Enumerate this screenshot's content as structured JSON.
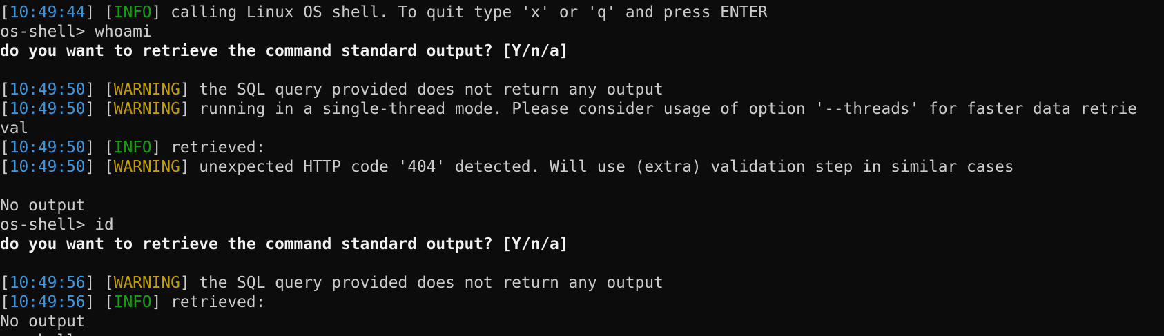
{
  "colors": {
    "background": "#0c0c0c",
    "text": "#cccccc",
    "timestamp": "#3a96dd",
    "info": "#13a10e",
    "warning": "#c19c00"
  },
  "lines": [
    {
      "type": "log",
      "time": "10:49:44",
      "level": "INFO",
      "msg": " calling Linux OS shell. To quit type 'x' or 'q' and press ENTER"
    },
    {
      "type": "prompt",
      "prompt": "os-shell> ",
      "cmd": "whoami"
    },
    {
      "type": "bold",
      "text": "do you want to retrieve the command standard output? [Y/n/a]"
    },
    {
      "type": "blank"
    },
    {
      "type": "log",
      "time": "10:49:50",
      "level": "WARNING",
      "msg": " the SQL query provided does not return any output"
    },
    {
      "type": "log",
      "time": "10:49:50",
      "level": "WARNING",
      "msg": " running in a single-thread mode. Please consider usage of option '--threads' for faster data retrie"
    },
    {
      "type": "text",
      "text": "val"
    },
    {
      "type": "log",
      "time": "10:49:50",
      "level": "INFO",
      "msg": " retrieved:"
    },
    {
      "type": "log",
      "time": "10:49:50",
      "level": "WARNING",
      "msg": " unexpected HTTP code '404' detected. Will use (extra) validation step in similar cases"
    },
    {
      "type": "blank"
    },
    {
      "type": "text",
      "text": "No output"
    },
    {
      "type": "prompt",
      "prompt": "os-shell> ",
      "cmd": "id"
    },
    {
      "type": "bold",
      "text": "do you want to retrieve the command standard output? [Y/n/a]"
    },
    {
      "type": "blank"
    },
    {
      "type": "log",
      "time": "10:49:56",
      "level": "WARNING",
      "msg": " the SQL query provided does not return any output"
    },
    {
      "type": "log",
      "time": "10:49:56",
      "level": "INFO",
      "msg": " retrieved:"
    },
    {
      "type": "text",
      "text": "No output"
    },
    {
      "type": "text",
      "text": "os-shell> "
    }
  ]
}
